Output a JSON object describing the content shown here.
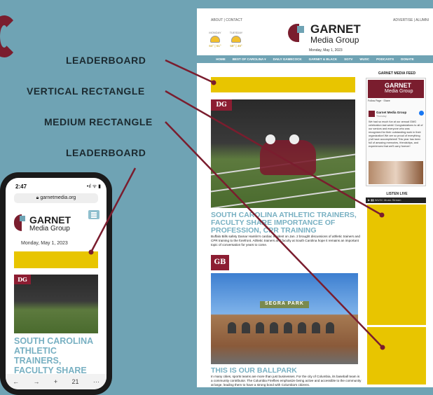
{
  "labels": {
    "leaderboard_1": "LEADERBOARD",
    "vertical_rectangle": "VERTICAL RECTANGLE",
    "medium_rectangle": "MEDIUM RECTANGLE",
    "leaderboard_2": "LEADERBOARD"
  },
  "desktop": {
    "top_left_links": "ABOUT | CONTACT",
    "top_right_links": "ADVERTISE | ALUMNI",
    "weather": [
      {
        "day": "MONDAY",
        "temp": "64° | 51°"
      },
      {
        "day": "TUESDAY",
        "temp": "59° | 48°"
      }
    ],
    "logo_line1": "GARNET",
    "logo_line2": "Media Group",
    "date": "Monday, May 1, 2023",
    "nav": [
      "HOME",
      "BEST OF CAROLINA ▾",
      "DAILY GAMECOCK",
      "GARNET & BLACK",
      "SGTV",
      "WUSC",
      "PODCASTS",
      "DONATE"
    ],
    "article1": {
      "badge": "DG",
      "title": "SOUTH CAROLINA ATHLETIC TRAINERS, FACULTY SHARE IMPORTANCE OF PROFESSION, CPR TRAINING",
      "body": "Buffalo Bills safety Damar Hamlin's cardiac incident on Jan. 2 brought discussions of athletic trainers and CPR training to the forefront. Athletic trainers and faculty at South Carolina hope it remains an important topic of conversation for years to come."
    },
    "article2": {
      "badge": "GB",
      "sign": "SEGRA PARK",
      "title": "THIS IS OUR BALLPARK",
      "body": "In many cities, sports teams are more than just businesses. For the city of Columbia, its baseball team is a community contributor. The Columbia Fireflies emphasize being active and accessible to the community at large, leading them to have a strong bond with Columbia's citizens."
    },
    "sidebar": {
      "feed_title": "GARNET MEDIA FEED",
      "fb_header_line1": "GARNET",
      "fb_header_line2": "Media Group",
      "fb_buttons": "Follow Page   ·   Share",
      "post_name": "Garnet Media Group",
      "post_date": "Thursday",
      "post_text": "We had so much fun at our annual GMG celebration last week! Congratulations to all of our seniors and everyone who was recognized for their outstanding work in their organization! We are so proud of everything y'all have accomplished! This year has been full of amazing memories, friendships, and experiences that we'll carry forever!",
      "listen_title": "LISTEN LIVE",
      "listen_bar": "▶ ▮▮  WUSC Music Stream"
    }
  },
  "phone": {
    "time": "2:47",
    "status_icons": "•ıl ᯤ ▮",
    "url": "garnetmedia.org",
    "logo_line1": "GARNET",
    "logo_line2": "Media Group",
    "date": "Monday, May 1, 2023",
    "badge": "DG",
    "title": "SOUTH CAROLINA ATHLETIC TRAINERS, FACULTY SHARE IMPORTANCE",
    "toolbar": [
      "←",
      "→",
      "+",
      "21",
      "···"
    ]
  },
  "colors": {
    "background": "#6fa3b4",
    "garnet": "#7a1d2e",
    "ad_yellow": "#e8c500",
    "headline_blue": "#78b0c2"
  }
}
